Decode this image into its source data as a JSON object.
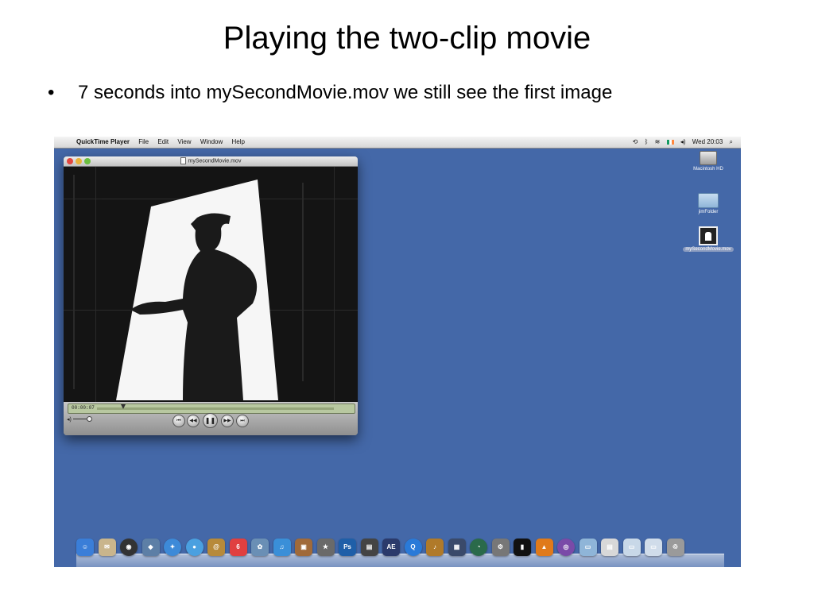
{
  "slide": {
    "title": "Playing the two-clip movie",
    "bullet_marker": "•",
    "bullet": "7 seconds into mySecondMovie.mov we still see the first image"
  },
  "menubar": {
    "apple": "",
    "app_name": "QuickTime Player",
    "menus": [
      "File",
      "Edit",
      "View",
      "Window",
      "Help"
    ],
    "clock": "Wed 20:03"
  },
  "player": {
    "title": "mySecondMovie.mov",
    "timecode": "00:00:07",
    "buttons": [
      {
        "name": "go-to-start-button",
        "glyph": "⏮"
      },
      {
        "name": "rewind-button",
        "glyph": "◀◀"
      },
      {
        "name": "pause-button",
        "glyph": "❚❚"
      },
      {
        "name": "fast-forward-button",
        "glyph": "▶▶"
      },
      {
        "name": "go-to-end-button",
        "glyph": "⏭"
      }
    ]
  },
  "desktop": {
    "icons": [
      {
        "label": "Macintosh HD",
        "icon": "hard-drive-icon"
      },
      {
        "label": "jimFolder",
        "icon": "folder-icon"
      },
      {
        "label": "mySecondMovie.mov",
        "icon": "movie-file-icon",
        "selected": true
      }
    ]
  },
  "dock": {
    "items": [
      {
        "name": "finder-icon",
        "color": "#3a7ed8",
        "glyph": "☺"
      },
      {
        "name": "mail-stamp-icon",
        "color": "#c9b58c",
        "glyph": "✉"
      },
      {
        "name": "dashboard-icon",
        "color": "#333333",
        "glyph": "◉"
      },
      {
        "name": "preview-icon",
        "color": "#5d7fa6",
        "glyph": "◆"
      },
      {
        "name": "safari-icon",
        "color": "#3d8ad8",
        "glyph": "✦"
      },
      {
        "name": "ichat-icon",
        "color": "#4aa0e0",
        "glyph": "●"
      },
      {
        "name": "address-book-icon",
        "color": "#b78a3a",
        "glyph": "@"
      },
      {
        "name": "ical-icon",
        "color": "#e04040",
        "glyph": "6"
      },
      {
        "name": "iphoto-icon",
        "color": "#6a8fb5",
        "glyph": "✿"
      },
      {
        "name": "itunes-icon",
        "color": "#3a8fd8",
        "glyph": "♫"
      },
      {
        "name": "iphoto-camera-icon",
        "color": "#a06a3a",
        "glyph": "▣"
      },
      {
        "name": "imovie-icon",
        "color": "#6a6a6a",
        "glyph": "★"
      },
      {
        "name": "photoshop-icon",
        "color": "#1f5fa8",
        "glyph": "Ps"
      },
      {
        "name": "final-cut-icon",
        "color": "#444444",
        "glyph": "▤"
      },
      {
        "name": "after-effects-icon",
        "color": "#2b3a6b",
        "glyph": "AE"
      },
      {
        "name": "quicktime-icon",
        "color": "#2a7ad8",
        "glyph": "Q"
      },
      {
        "name": "garageband-icon",
        "color": "#b07a2a",
        "glyph": "♪"
      },
      {
        "name": "spaces-icon",
        "color": "#3a4a6a",
        "glyph": "▦"
      },
      {
        "name": "time-machine-icon",
        "color": "#2a6a4a",
        "glyph": "◔"
      },
      {
        "name": "system-preferences-icon",
        "color": "#777777",
        "glyph": "⚙"
      },
      {
        "name": "terminal-icon",
        "color": "#111111",
        "glyph": "▮"
      },
      {
        "name": "vlc-icon",
        "color": "#e07a1a",
        "glyph": "▲"
      },
      {
        "name": "dvd-player-icon",
        "color": "#7a4aa8",
        "glyph": "◎"
      },
      {
        "name": "applications-folder-icon",
        "color": "#8fb5d8",
        "glyph": "▭"
      },
      {
        "name": "documents-stack-icon",
        "color": "#d8d8d8",
        "glyph": "▤"
      },
      {
        "name": "downloads-stack-icon",
        "color": "#c8d8e8",
        "glyph": "▭"
      },
      {
        "name": "mail-stack-icon",
        "color": "#d0dcea",
        "glyph": "▭"
      },
      {
        "name": "trash-icon",
        "color": "#9a9a9a",
        "glyph": "♲"
      }
    ]
  }
}
